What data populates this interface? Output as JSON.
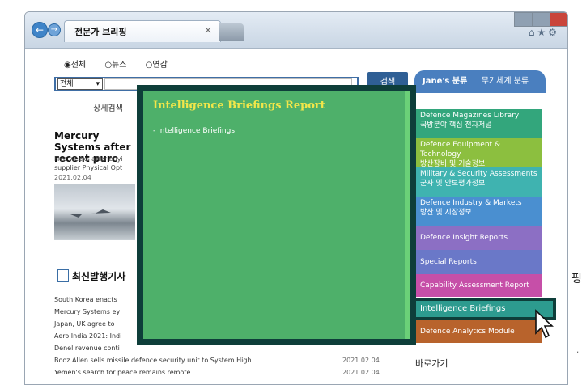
{
  "edge": {
    "left_char": "핑",
    "bottom_mark": ","
  },
  "browser": {
    "tab_title": "전문가 브리핑",
    "tab_close": "×",
    "nav_back": "←",
    "nav_forward": "→",
    "toolbar_icons": "⌂★⚙"
  },
  "search": {
    "radio_all": "◉전체",
    "radio_news": "○뉴스",
    "radio_yearbook": "○연감",
    "select_value": "전체",
    "button": "검색",
    "janes_label": "Jane's 분류",
    "weapon_label": "무기체계 분류",
    "detail_link": "상세검색"
  },
  "featured": {
    "title": "Mercury Systems after recent purc",
    "desc": "Five weeks after buyi supplier Physical Opt",
    "date": "2021.02.04"
  },
  "latest": {
    "title": "최신발행기사",
    "items": [
      {
        "title": "South Korea enacts",
        "date": ""
      },
      {
        "title": "Mercury Systems ey",
        "date": ""
      },
      {
        "title": "Japan, UK agree to",
        "date": ""
      },
      {
        "title": "Aero India 2021: Indi",
        "date": ""
      },
      {
        "title": "Denel revenue conti",
        "date": ""
      },
      {
        "title": "Booz Allen sells missile defence security unit to System High",
        "date": "2021.02.04"
      },
      {
        "title": "Yemen's search for peace remains remote",
        "date": "2021.02.04"
      }
    ]
  },
  "panel": {
    "title": "Intelligence Briefings Report",
    "link": "- Intelligence Briefings"
  },
  "categories": [
    {
      "en": "Defence Magazines Library",
      "ko": "국방분야 핵심 전자저널",
      "color": "#33a67c"
    },
    {
      "en": "Defence Equipment & Technology",
      "ko": "방산장비 및 기술정보",
      "color": "#8cbf3f"
    },
    {
      "en": "Military & Security Assessments",
      "ko": "군사 및 안보평가정보",
      "color": "#3fb3b0"
    },
    {
      "en": "Defence Industry & Markets",
      "ko": "방산 및 시장정보",
      "color": "#4a8fd0"
    },
    {
      "en": "Defence Insight Reports",
      "ko": "",
      "color": "#8c6fc4"
    },
    {
      "en": "Special Reports",
      "ko": "",
      "color": "#6a78c8"
    },
    {
      "en": "Capability Assessment Report",
      "ko": "",
      "color": "#c64fa8"
    }
  ],
  "selected_category": "Intelligence Briefings",
  "analytics_category": {
    "en": "Defence Analytics Module",
    "color": "#b8632c"
  },
  "shortcut": "바로가기",
  "colors": {
    "panel_bg": "#4eb06a",
    "panel_border": "#0e3e3a",
    "panel_title": "#f2e64a"
  }
}
